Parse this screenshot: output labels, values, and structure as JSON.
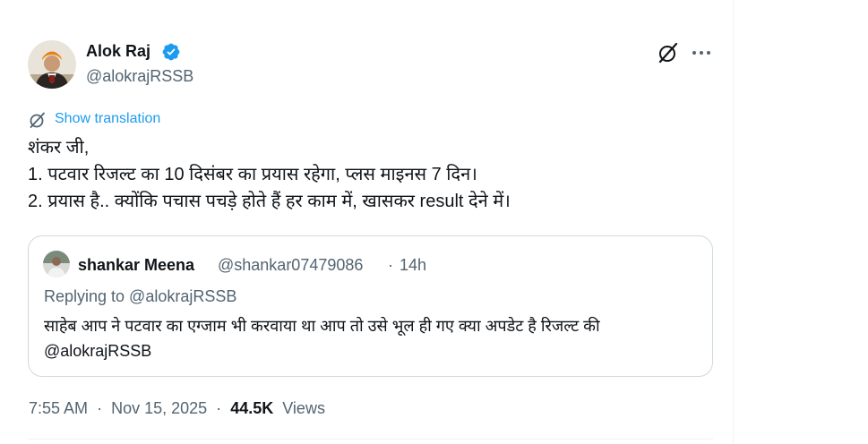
{
  "tweet": {
    "author_name": "Alok Raj",
    "author_handle": "@alokrajRSSB",
    "show_translation": "Show translation",
    "text_lines": [
      "शंकर जी,",
      "1. पटवार रिजल्ट का 10 दिसंबर का प्रयास रहेगा, प्लस माइनस 7 दिन।",
      "2. प्रयास है.. क्योंकि पचास पचड़े होते हैं हर काम में, खासकर result देने में।"
    ],
    "time": "7:55 AM",
    "separator": "·",
    "date": "Nov 15, 2025",
    "views_count": "44.5K",
    "views_label": "Views"
  },
  "quote": {
    "author_name": "shankar Meena",
    "author_handle": "@shankar07479086",
    "separator": "·",
    "time_ago": "14h",
    "replying_to": "Replying to @alokrajRSSB",
    "text": "साहेब आप ने पटवार का एग्जाम भी करवाया था आप तो उसे भूल ही गए  क्या अपडेट है रिजल्ट की @alokrajRSSB"
  },
  "icons": {
    "verified": "verified-badge-icon",
    "grok": "grok-icon",
    "more": "more-options-icon",
    "translate": "translate-icon"
  },
  "colors": {
    "accent": "#1d9bf0",
    "secondary_text": "#536471",
    "primary_text": "#0f1419",
    "border": "#cfd9de"
  }
}
